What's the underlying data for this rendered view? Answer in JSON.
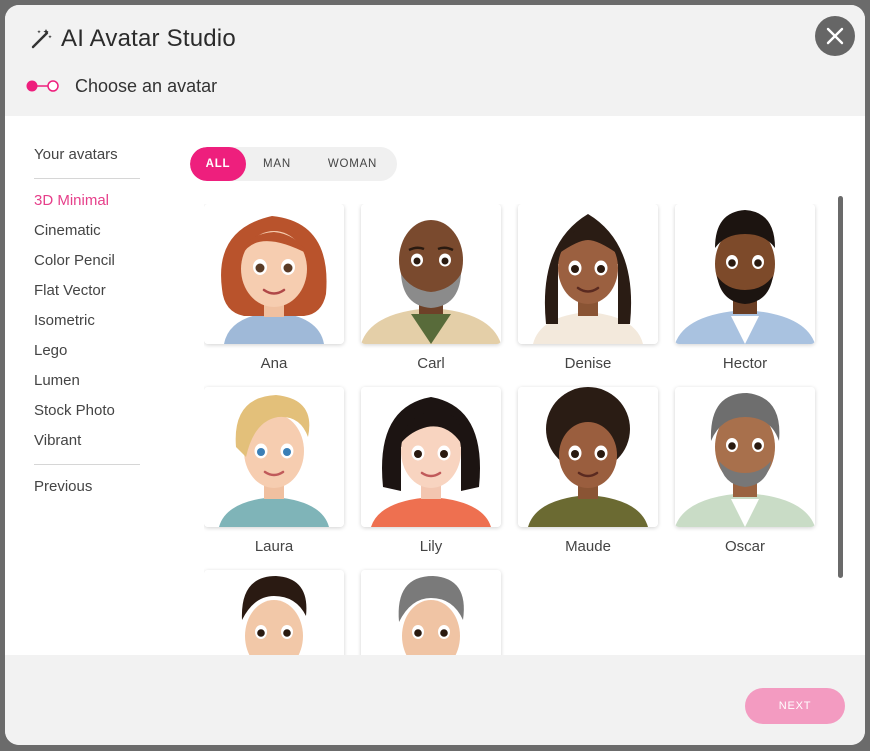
{
  "header": {
    "title": "AI Avatar Studio",
    "step_label": "Choose an avatar",
    "title_icon": "magic-wand-icon",
    "close_icon": "close-icon"
  },
  "sidebar": {
    "heading": "Your avatars",
    "items": [
      "3D Minimal",
      "Cinematic",
      "Color Pencil",
      "Flat Vector",
      "Isometric",
      "Lego",
      "Lumen",
      "Stock Photo",
      "Vibrant"
    ],
    "active": "3D Minimal",
    "previous": "Previous"
  },
  "filters": {
    "all": "ALL",
    "man": "MAN",
    "woman": "WOMAN",
    "selected": "ALL"
  },
  "avatars": [
    {
      "name": "Ana"
    },
    {
      "name": "Carl"
    },
    {
      "name": "Denise"
    },
    {
      "name": "Hector"
    },
    {
      "name": "Laura"
    },
    {
      "name": "Lily"
    },
    {
      "name": "Maude"
    },
    {
      "name": "Oscar"
    },
    {
      "name": ""
    },
    {
      "name": ""
    }
  ],
  "footer": {
    "next_label": "NEXT"
  },
  "colors": {
    "accent": "#ee1f7d",
    "next_disabled": "#f39bc1"
  }
}
